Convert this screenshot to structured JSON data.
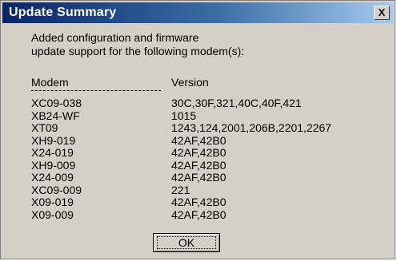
{
  "window": {
    "title": "Update Summary",
    "close_label": "X"
  },
  "intro": {
    "line1": "Added configuration and firmware",
    "line2": "update support for the following modem(s):"
  },
  "table": {
    "headers": {
      "modem": "Modem",
      "version": "Version"
    },
    "separator": "----------------------------------------",
    "rows": [
      {
        "modem": "XC09-038",
        "version": "30C,30F,321,40C,40F,421"
      },
      {
        "modem": "XB24-WF",
        "version": "1015"
      },
      {
        "modem": "XT09",
        "version": "1243,124,2001,206B,2201,2267"
      },
      {
        "modem": "XH9-019",
        "version": "42AF,42B0"
      },
      {
        "modem": "X24-019",
        "version": "42AF,42B0"
      },
      {
        "modem": "XH9-009",
        "version": "42AF,42B0"
      },
      {
        "modem": "X24-009",
        "version": "42AF,42B0"
      },
      {
        "modem": "XC09-009",
        "version": "221"
      },
      {
        "modem": "X09-019",
        "version": "42AF,42B0"
      },
      {
        "modem": "X09-009",
        "version": "42AF,42B0"
      }
    ]
  },
  "buttons": {
    "ok_label": "OK"
  },
  "colors": {
    "title_gradient_start": "#0a246a",
    "title_gradient_end": "#a6caf0",
    "dialog_face": "#d4d0c8"
  }
}
